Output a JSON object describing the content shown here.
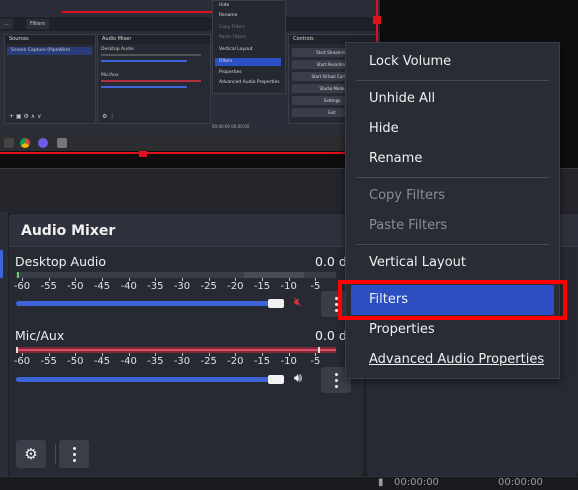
{
  "preview": {
    "mini_tabs": [
      "...",
      "Filters"
    ],
    "sources_title": "Sources",
    "sources_item": "Screen Capture (PipeWire)",
    "audio_title": "Audio Mixer",
    "audio_ch1": "Desktop Audio",
    "audio_ch2": "Mic/Aux",
    "controls_title": "Controls",
    "controls_buttons": [
      "Start Streaming",
      "Start Recording",
      "Start Virtual Camera",
      "Studio Mode",
      "Settings",
      "Exit"
    ],
    "mini_menu": [
      "Hide",
      "Rename",
      "Copy Filters",
      "Paste Filters",
      "Vertical Layout",
      "Filters",
      "Properties",
      "Advanced Audio Properties"
    ],
    "status_text": "00:00:00   00:00:00"
  },
  "mixer": {
    "title": "Audio Mixer",
    "channels": [
      {
        "name": "Desktop Audio",
        "db": "0.0 d",
        "level": 1.0,
        "muted": true
      },
      {
        "name": "Mic/Aux",
        "db": "0.0 d",
        "level": 1.0,
        "muted": false
      }
    ],
    "ticks": [
      "-60",
      "-55",
      "-50",
      "-45",
      "-40",
      "-35",
      "-30",
      "-25",
      "-20",
      "-15",
      "-10",
      "-5"
    ]
  },
  "context_menu": {
    "items": [
      {
        "label": "Lock Volume",
        "enabled": true
      },
      {
        "label": "Unhide All",
        "enabled": true
      },
      {
        "label": "Hide",
        "enabled": true
      },
      {
        "label": "Rename",
        "enabled": true
      },
      {
        "label": "Copy Filters",
        "enabled": false
      },
      {
        "label": "Paste Filters",
        "enabled": false
      },
      {
        "label": "Vertical Layout",
        "enabled": true
      },
      {
        "label": "Filters",
        "enabled": true,
        "selected": true
      },
      {
        "label": "Properties",
        "enabled": true
      },
      {
        "label": "Advanced Audio Properties",
        "enabled": true
      }
    ]
  },
  "statusbar": {
    "time1": "00:00:00",
    "time2": "00:00:00"
  },
  "colors": {
    "accent": "#2b4fc2",
    "highlight_border": "#ff0000",
    "mute_red": "#e0333a"
  }
}
